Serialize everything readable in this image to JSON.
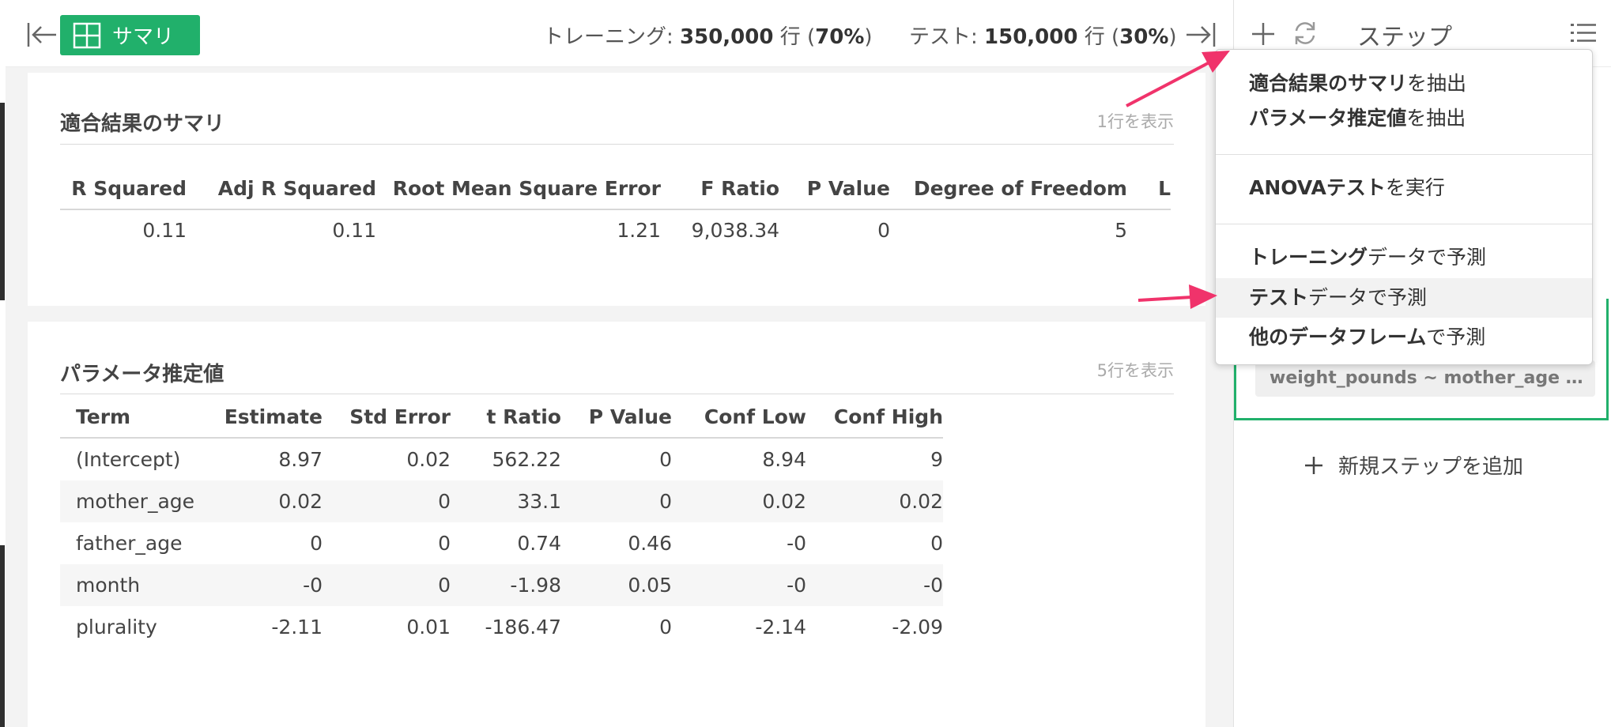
{
  "header": {
    "summary_button_label": "サマリ",
    "training": {
      "label": "トレーニング: ",
      "count": "350,000",
      "unit": " 行 (",
      "pct": "70%",
      "close": ")"
    },
    "test": {
      "label": "テスト: ",
      "count": "150,000",
      "unit": " 行 (",
      "pct": "30%",
      "close": ")"
    }
  },
  "fit_summary": {
    "title": "適合結果のサマリ",
    "rows_shown": "1行を表示",
    "columns": [
      "R Squared",
      "Adj R Squared",
      "Root Mean Square Error",
      "F Ratio",
      "P Value",
      "Degree of Freedom",
      "L"
    ],
    "rows": [
      [
        "0.11",
        "0.11",
        "1.21",
        "9,038.34",
        "0",
        "5",
        ""
      ]
    ]
  },
  "params": {
    "title": "パラメータ推定値",
    "rows_shown": "5行を表示",
    "columns": [
      "Term",
      "Estimate",
      "Std Error",
      "t Ratio",
      "P Value",
      "Conf Low",
      "Conf High"
    ],
    "rows": [
      [
        "(Intercept)",
        "8.97",
        "0.02",
        "562.22",
        "0",
        "8.94",
        "9"
      ],
      [
        "mother_age",
        "0.02",
        "0",
        "33.1",
        "0",
        "0.02",
        "0.02"
      ],
      [
        "father_age",
        "0",
        "0",
        "0.74",
        "0.46",
        "-0",
        "0"
      ],
      [
        "month",
        "-0",
        "0",
        "-1.98",
        "0.05",
        "-0",
        "-0"
      ],
      [
        "plurality",
        "-2.11",
        "0.01",
        "-186.47",
        "0",
        "-2.14",
        "-2.09"
      ]
    ]
  },
  "right_panel": {
    "title": "ステップ",
    "formula": "weight_pounds ~ mother_age + f…",
    "add_step": "新規ステップを追加"
  },
  "menu": {
    "items": [
      {
        "bold": "適合結果のサマリ",
        "rest": "を抽出"
      },
      {
        "bold": "パラメータ推定値",
        "rest": "を抽出"
      },
      {
        "bold": "ANOVAテスト",
        "rest": "を実行"
      },
      {
        "bold": "トレーニング",
        "rest": "データで予測"
      },
      {
        "bold": "テスト",
        "rest": "データで予測"
      },
      {
        "bold": "他のデータフレーム",
        "rest": "で予測"
      }
    ]
  },
  "colors": {
    "accent_green": "#21b06b",
    "arrow_pink": "#f0336b"
  }
}
